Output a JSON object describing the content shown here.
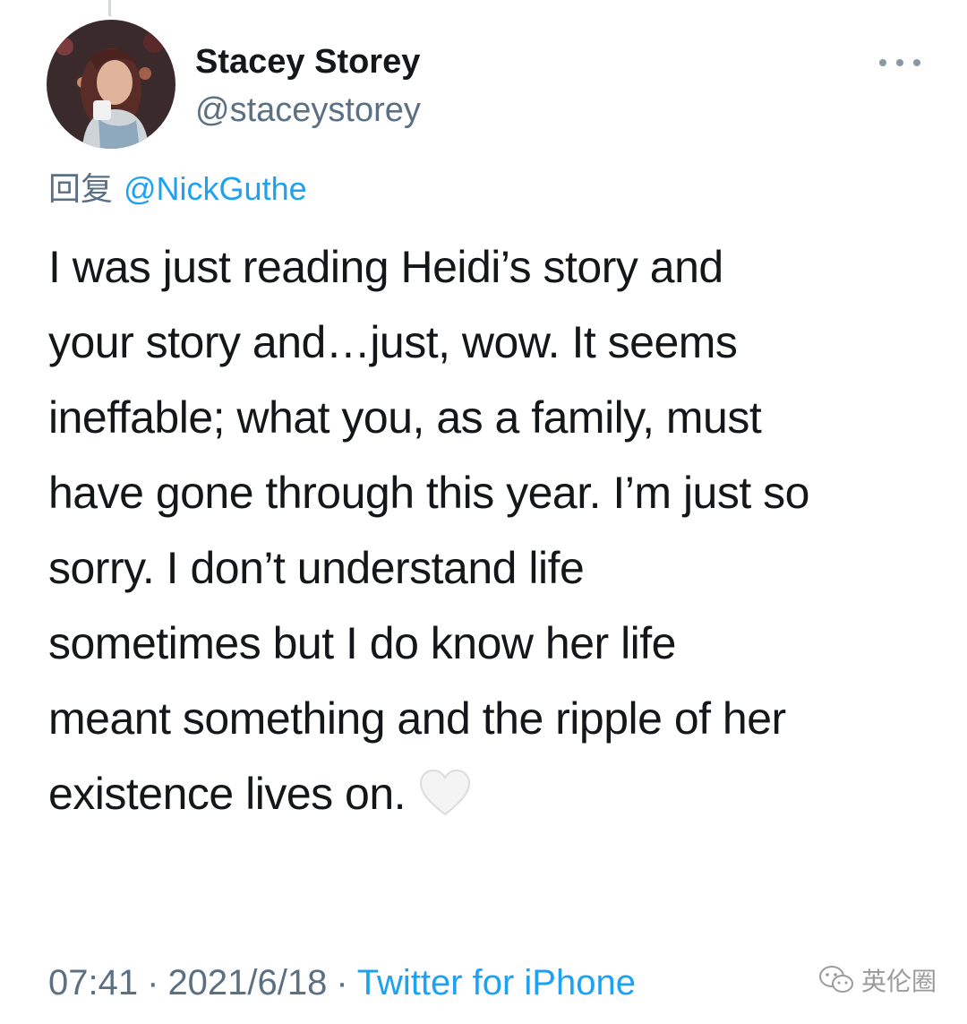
{
  "author": {
    "display_name": "Stacey Storey",
    "handle": "@staceystorey"
  },
  "reply": {
    "prefix": "回复",
    "mention": "@NickGuthe"
  },
  "tweet": {
    "lines": [
      "I was just reading Heidi’s story and",
      "your story and…just, wow. It seems",
      "ineffable; what you, as a family, must",
      "have gone through this year. I’m just so",
      "sorry. I don’t understand life",
      "sometimes but I do know her life",
      "meant something and the ripple of her",
      "existence lives on."
    ],
    "emoji": "white-heart-icon"
  },
  "meta": {
    "time": "07:41",
    "separator": "·",
    "date": "2021/6/18",
    "source": "Twitter for iPhone"
  },
  "watermark": {
    "text": "英伦圈",
    "icon": "wechat-icon"
  },
  "colors": {
    "text": "#14171a",
    "secondary": "#5b7083",
    "link": "#1da1f2"
  }
}
